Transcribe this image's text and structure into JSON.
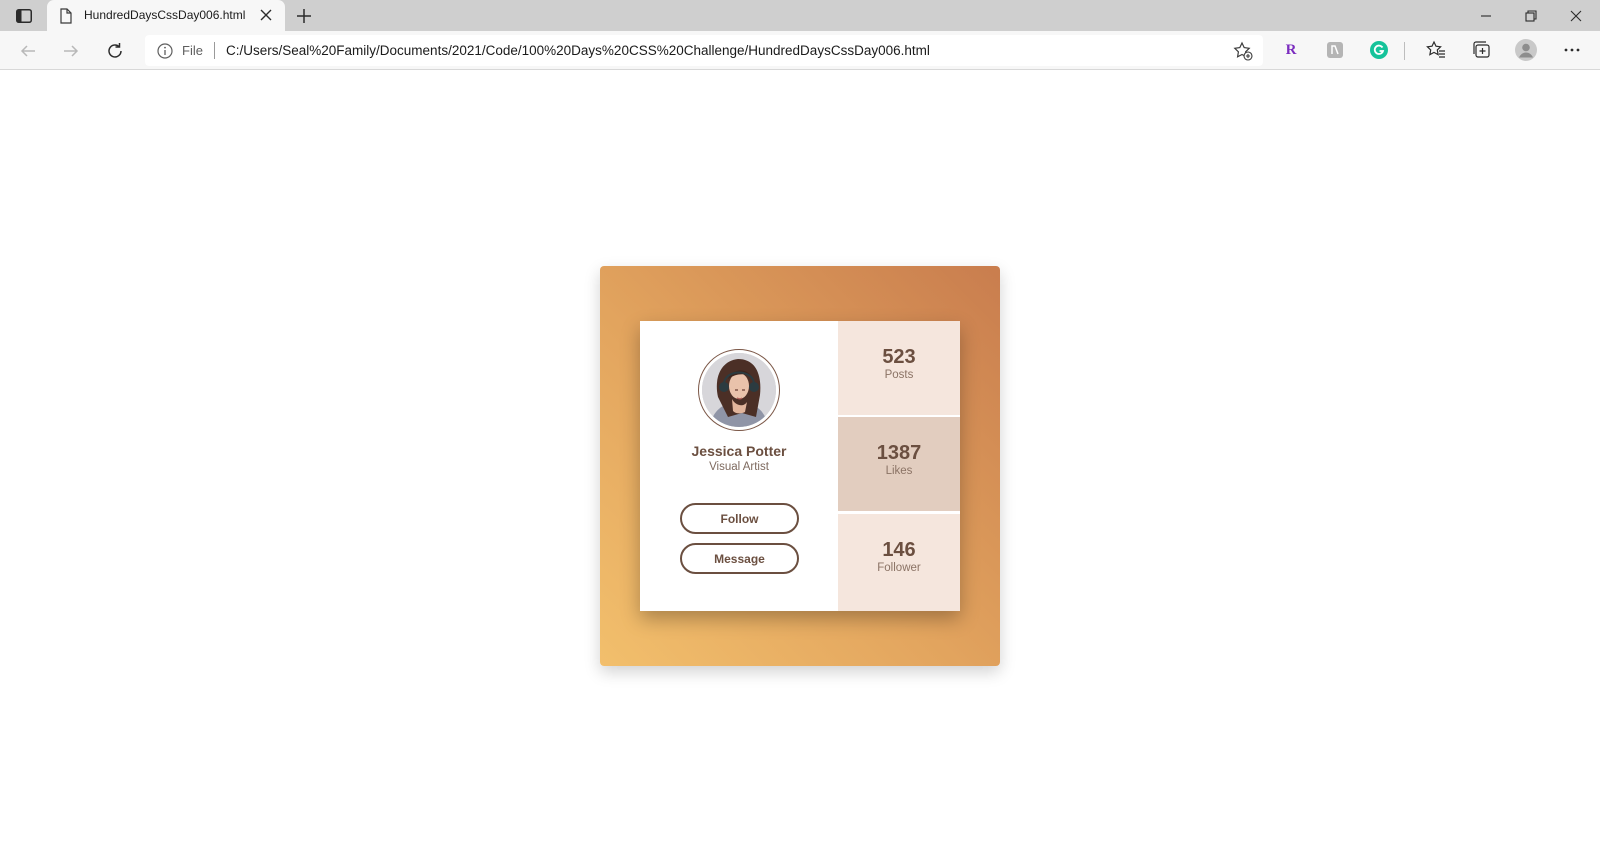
{
  "browser": {
    "tab_title": "HundredDaysCssDay006.html",
    "address_scheme_label": "File",
    "url": "C:/Users/Seal%20Family/Documents/2021/Code/100%20Days%20CSS%20Challenge/HundredDaysCssDay006.html",
    "extensions": [
      {
        "name": "R",
        "color": "#7b2cbf"
      },
      {
        "name": "extension-icon",
        "color": "#9a9a9a"
      },
      {
        "name": "G",
        "color": "#15c39a"
      }
    ]
  },
  "profile": {
    "name": "Jessica Potter",
    "role": "Visual Artist",
    "follow_label": "Follow",
    "message_label": "Message",
    "stats": [
      {
        "value": "523",
        "label": "Posts",
        "bg": "#f5e6dd"
      },
      {
        "value": "1387",
        "label": "Likes",
        "bg": "#e2cdbf"
      },
      {
        "value": "146",
        "label": "Follower",
        "bg": "#f5e6dd"
      }
    ]
  },
  "colors": {
    "accent_brown": "#6b4f40",
    "gradient": [
      "#f2bf6c",
      "#e2a45e",
      "#c97d4e"
    ]
  }
}
